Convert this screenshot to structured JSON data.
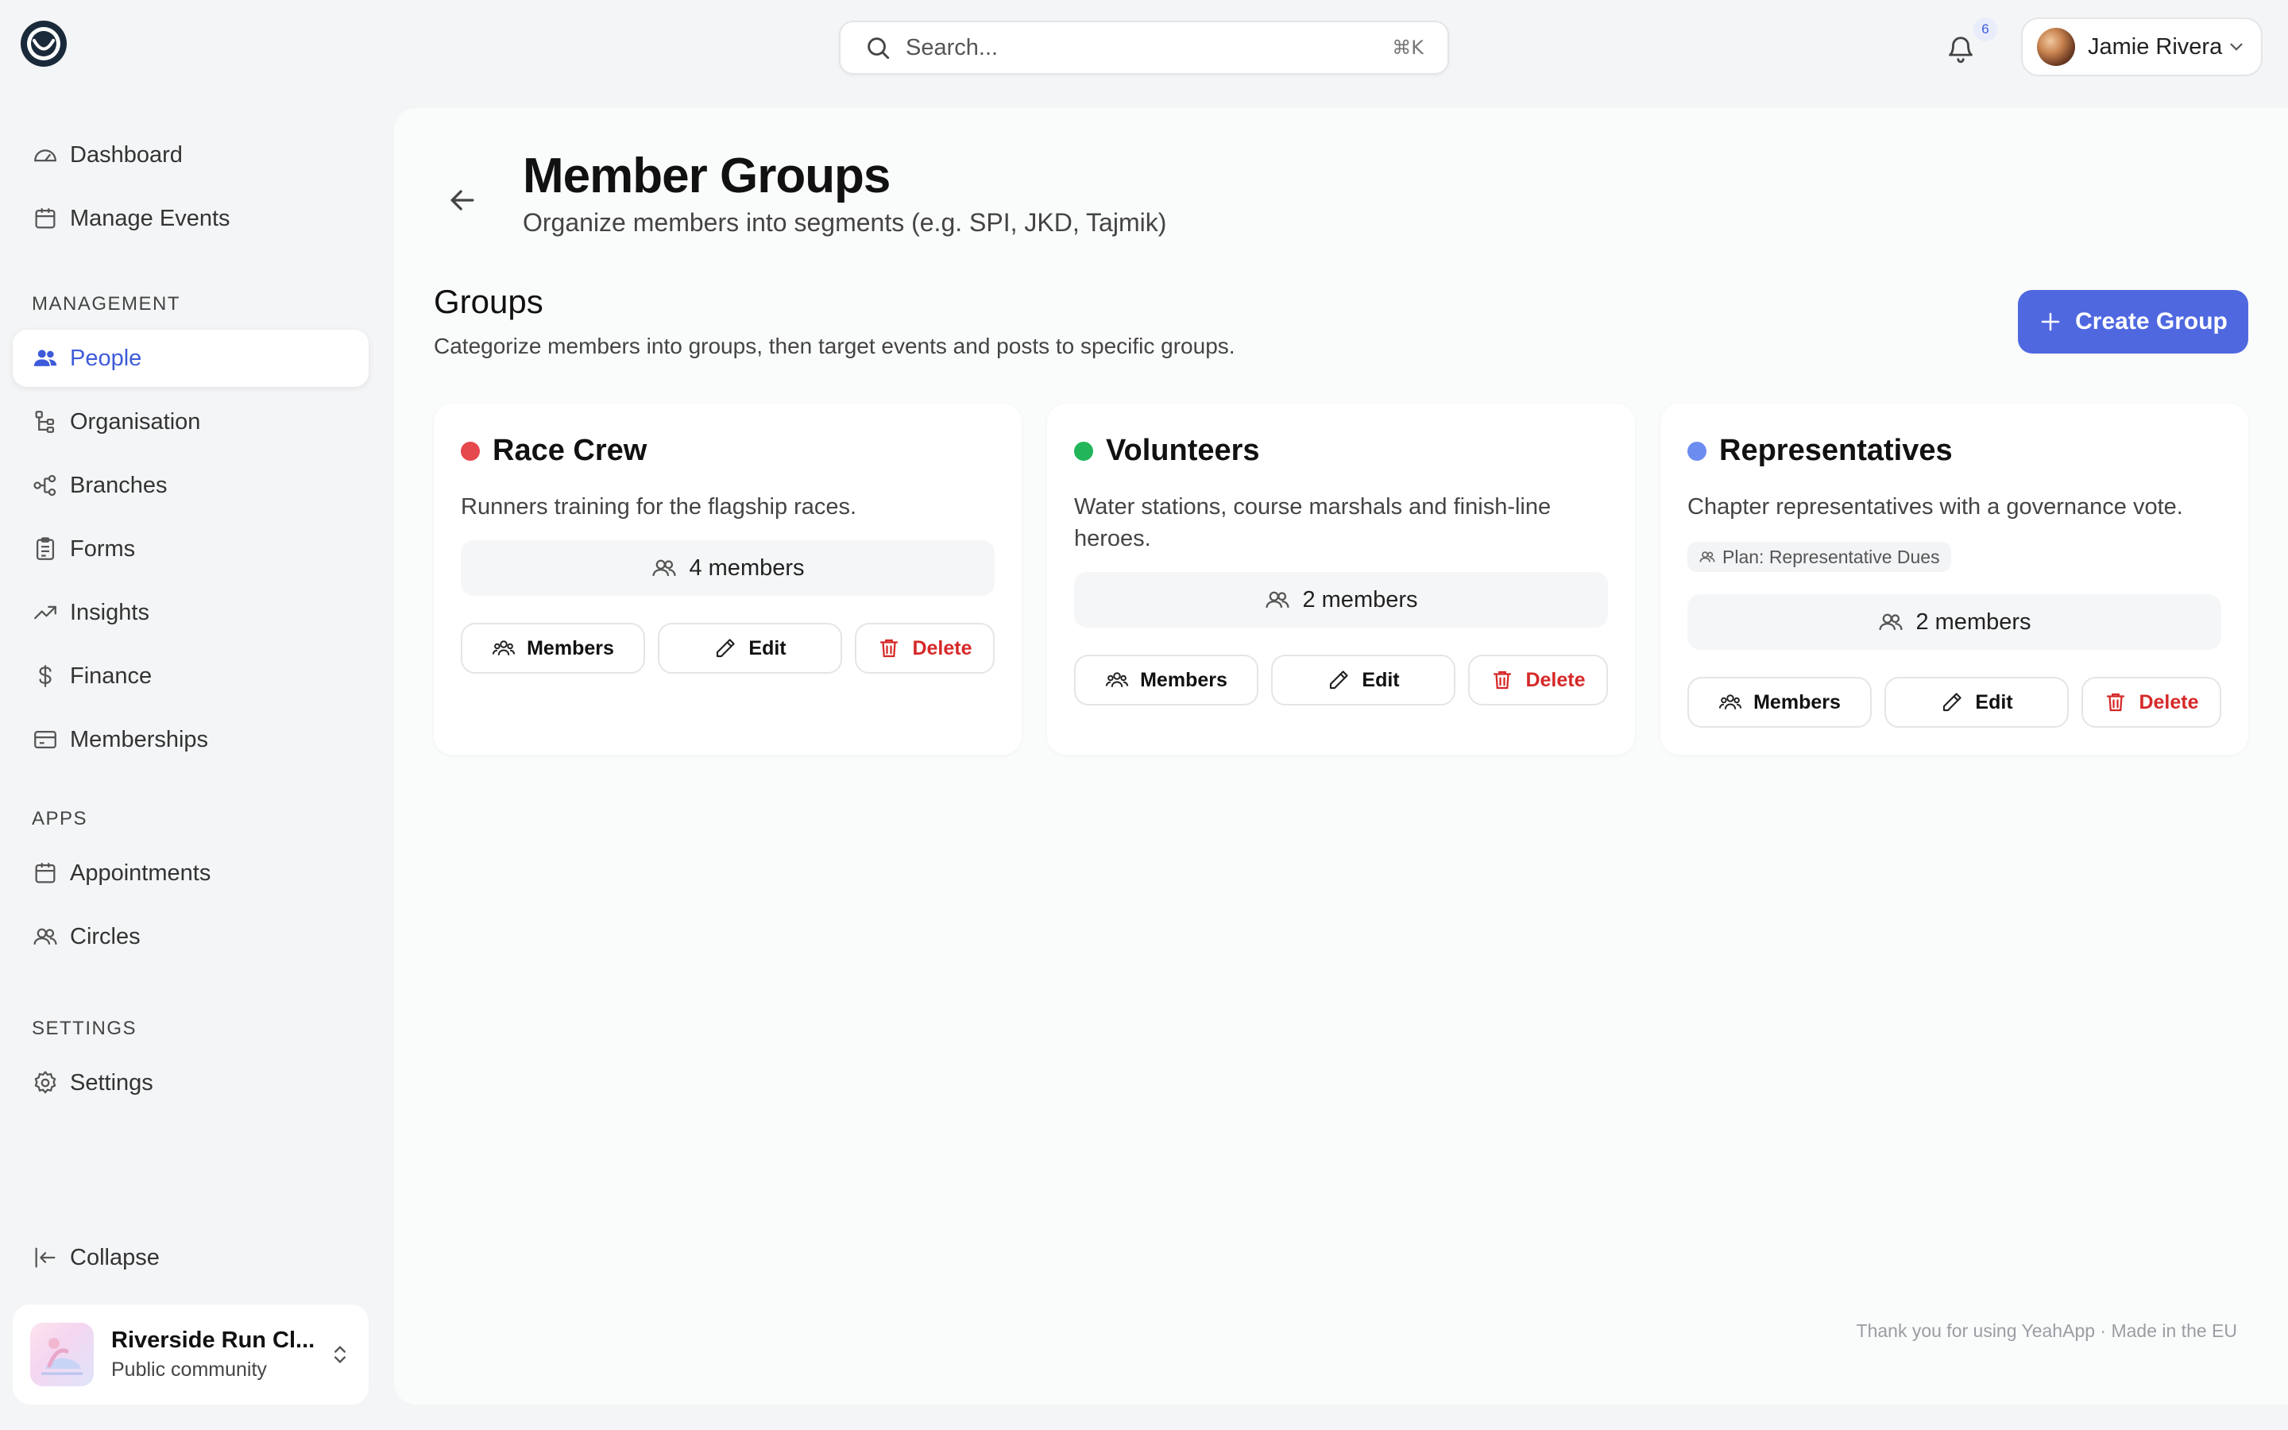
{
  "header": {
    "search_placeholder": "Search...",
    "search_shortcut": "⌘K",
    "notification_count": "6",
    "user_name": "Jamie Rivera"
  },
  "sidebar": {
    "top_items": [
      {
        "label": "Dashboard",
        "icon": "gauge-icon"
      },
      {
        "label": "Manage Events",
        "icon": "calendar-icon"
      }
    ],
    "management_title": "MANAGEMENT",
    "management_items": [
      {
        "label": "People",
        "icon": "people-icon",
        "active": true
      },
      {
        "label": "Organisation",
        "icon": "org-tree-icon"
      },
      {
        "label": "Branches",
        "icon": "branches-icon"
      },
      {
        "label": "Forms",
        "icon": "clipboard-icon"
      },
      {
        "label": "Insights",
        "icon": "trending-up-icon"
      },
      {
        "label": "Finance",
        "icon": "dollar-icon"
      },
      {
        "label": "Memberships",
        "icon": "card-icon"
      }
    ],
    "apps_title": "APPS",
    "apps_items": [
      {
        "label": "Appointments",
        "icon": "calendar-icon"
      },
      {
        "label": "Circles",
        "icon": "users-icon"
      }
    ],
    "settings_title": "SETTINGS",
    "settings_items": [
      {
        "label": "Settings",
        "icon": "gear-icon"
      }
    ],
    "collapse_label": "Collapse",
    "org": {
      "name": "Riverside Run Cl...",
      "subtitle": "Public community"
    }
  },
  "page": {
    "title": "Member Groups",
    "subtitle": "Organize members into segments (e.g. SPI, JKD, Tajmik)",
    "section_title": "Groups",
    "section_desc": "Categorize members into groups, then target events and posts to specific groups.",
    "create_label": "Create Group",
    "accent": "#4f68e0"
  },
  "groups": [
    {
      "name": "Race Crew",
      "color": "#e5484d",
      "description": "Runners training for the flagship races.",
      "count": "4 members"
    },
    {
      "name": "Volunteers",
      "color": "#22b55a",
      "description": "Water stations, course marshals and finish-line heroes.",
      "count": "2 members"
    },
    {
      "name": "Representatives",
      "color": "#6d8cf0",
      "description": "Chapter representatives with a governance vote.",
      "plan": "Plan: Representative Dues",
      "count": "2 members"
    }
  ],
  "card_actions": {
    "members": "Members",
    "edit": "Edit",
    "delete": "Delete"
  },
  "footer": "Thank you for using YeahApp · Made in the EU"
}
